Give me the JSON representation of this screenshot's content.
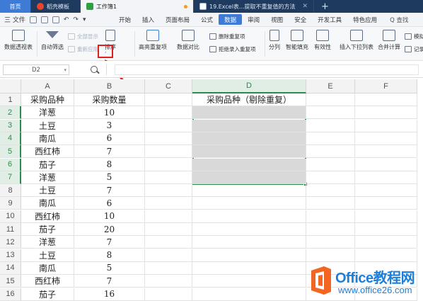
{
  "tabs": [
    {
      "label": "首页"
    },
    {
      "label": "稻壳模板"
    },
    {
      "label": "工作簿1"
    },
    {
      "label": "19.Excel表...提取不重复值的方法"
    }
  ],
  "menu": {
    "file_label": "三 文件",
    "items": [
      "开始",
      "插入",
      "页面布局",
      "公式",
      "数据",
      "审阅",
      "视图",
      "安全",
      "开发工具",
      "特色应用"
    ],
    "active": "数据",
    "search_label": "Q 查找"
  },
  "ribbon": {
    "pivot": "数据透视表",
    "auto_filter": "自动筛选",
    "show_all": "全部显示",
    "reapply": "重新应用",
    "sort": "排序",
    "highlight_dup": "高亮重复项",
    "compare": "数据对比",
    "remove_dup": "删除重复项",
    "reject_dup": "拒绝录入重复项",
    "split": "分列",
    "smart_fill": "智能填充",
    "validity": "有效性",
    "dropdown": "插入下拉列表",
    "consolidate": "合并计算",
    "simulate": "模拟",
    "record": "记录"
  },
  "formula_bar": {
    "name_box": "D2",
    "formula": ""
  },
  "sheet": {
    "columns": [
      "A",
      "B",
      "C",
      "D",
      "E",
      "F"
    ],
    "selected_column": "D",
    "rows": [
      {
        "n": "1",
        "a": "采购品种",
        "b": "采购数量",
        "d": "采购品种（剔除重复）"
      },
      {
        "n": "2",
        "a": "洋葱",
        "b": "10"
      },
      {
        "n": "3",
        "a": "土豆",
        "b": "3"
      },
      {
        "n": "4",
        "a": "南瓜",
        "b": "6"
      },
      {
        "n": "5",
        "a": "西红柿",
        "b": "7"
      },
      {
        "n": "6",
        "a": "茄子",
        "b": "8"
      },
      {
        "n": "7",
        "a": "洋葱",
        "b": "5"
      },
      {
        "n": "8",
        "a": "土豆",
        "b": "7"
      },
      {
        "n": "9",
        "a": "南瓜",
        "b": "6"
      },
      {
        "n": "10",
        "a": "西红柿",
        "b": "10"
      },
      {
        "n": "11",
        "a": "茄子",
        "b": "20"
      },
      {
        "n": "12",
        "a": "洋葱",
        "b": "7"
      },
      {
        "n": "13",
        "a": "土豆",
        "b": "8"
      },
      {
        "n": "14",
        "a": "南瓜",
        "b": "5"
      },
      {
        "n": "15",
        "a": "西红柿",
        "b": "7"
      },
      {
        "n": "16",
        "a": "茄子",
        "b": "16"
      }
    ]
  },
  "watermark": {
    "brand": "Office教程网",
    "site": "www.office26.com"
  },
  "colors": {
    "accent": "#3d7bd6",
    "selection": "#2d8a4a",
    "highlight": "#e02020",
    "watermark": "#1e7fd8"
  }
}
